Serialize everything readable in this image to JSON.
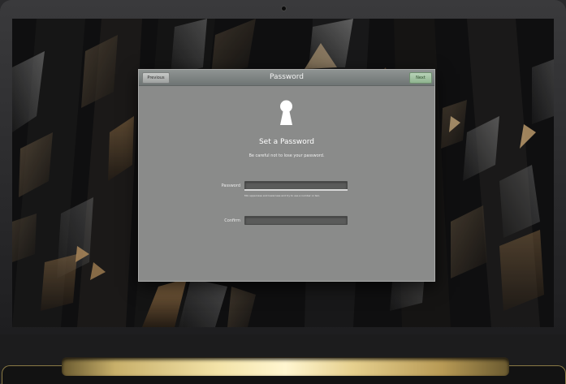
{
  "dialog": {
    "title": "Password",
    "previous_label": "Previous",
    "next_label": "Next",
    "heading": "Set a Password",
    "subtext": "Be careful not to lose your password.",
    "password_label": "Password",
    "password_value": "",
    "hint": "Mix uppercase and lowercase and try to use a number or two.",
    "confirm_label": "Confirm",
    "confirm_value": ""
  },
  "icons": {
    "keyhole": "keyhole-icon"
  },
  "colors": {
    "dialog_bg": "#8a8b8a",
    "next_button": "#a3c3a3",
    "hinge_gold": "#e6d08e"
  }
}
